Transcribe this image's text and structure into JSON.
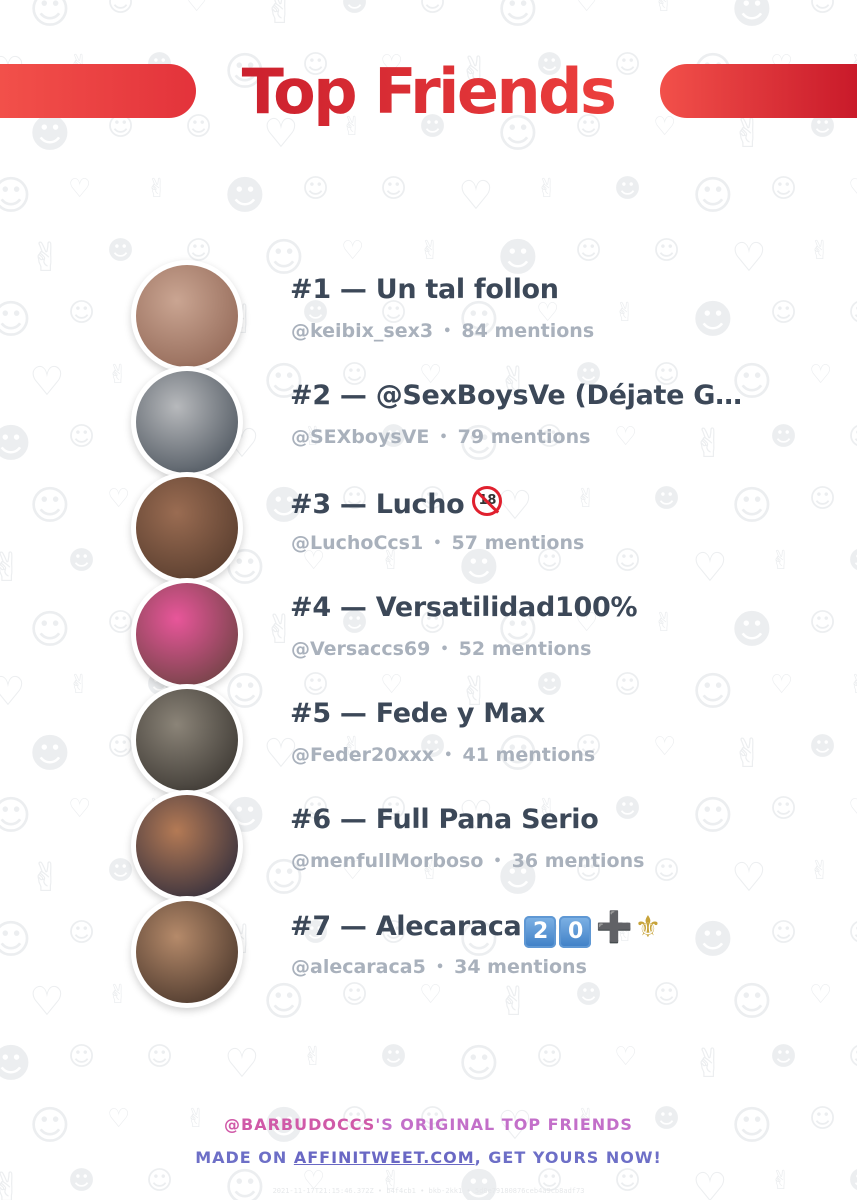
{
  "header": {
    "title": "Top Friends"
  },
  "colors": {
    "title_start": "#c81d2c",
    "title_end": "#f0433f",
    "name_text": "#3c4858",
    "meta_text": "#a9b1bc",
    "footer_pink": "#c36fc9",
    "footer_blue": "#6d6fc7"
  },
  "friends": [
    {
      "label": "#1 — Un tal follon",
      "handle": "@keibix_sex3",
      "mentions": "84 mentions",
      "avatar_colors": [
        "#caa592",
        "#8a5f4e"
      ]
    },
    {
      "label": "#2 — @SexBoysVe (Déjate G…",
      "handle": "@SEXboysVE",
      "mentions": "79 mentions",
      "avatar_colors": [
        "#b7b9bc",
        "#3d4650"
      ]
    },
    {
      "label": "#3 — Lucho",
      "emoji": "18",
      "handle": "@LuchoCcs1",
      "mentions": "57 mentions",
      "avatar_colors": [
        "#9a6c52",
        "#4d3528"
      ]
    },
    {
      "label": "#4 — Versatilidad100%",
      "handle": "@Versaccs69",
      "mentions": "52 mentions",
      "avatar_colors": [
        "#e8569a",
        "#5b3f35"
      ]
    },
    {
      "label": "#5 — Fede y Max",
      "handle": "@Feder20xxx",
      "mentions": "41 mentions",
      "avatar_colors": [
        "#8b8478",
        "#2f2b27"
      ]
    },
    {
      "label": "#6 — Full Pana Serio",
      "handle": "@menfullMorboso",
      "mentions": "36 mentions",
      "avatar_colors": [
        "#b47a55",
        "#1e2238"
      ]
    },
    {
      "label": "#7 — Alecaraca",
      "keycaps": [
        "2",
        "0"
      ],
      "plus": "➕",
      "fleur": "⚜",
      "handle": "@alecaraca5",
      "mentions": "34 mentions",
      "avatar_colors": [
        "#b58a6a",
        "#3a2a22"
      ]
    }
  ],
  "footer": {
    "handle": "@BARBUDOCCS",
    "line1_rest": "'S ORIGINAL TOP FRIENDS",
    "line2_prefix": "MADE ON ",
    "link": "AFFINITWEET.COM",
    "line2_suffix": ", GET YOURS NOW!"
  },
  "fine_print": "2021-11-17T21:15:46.372Z • b4f4cb1 • bkb-2kk1 • 5d8e79180876ceb4a9cb8adf73"
}
